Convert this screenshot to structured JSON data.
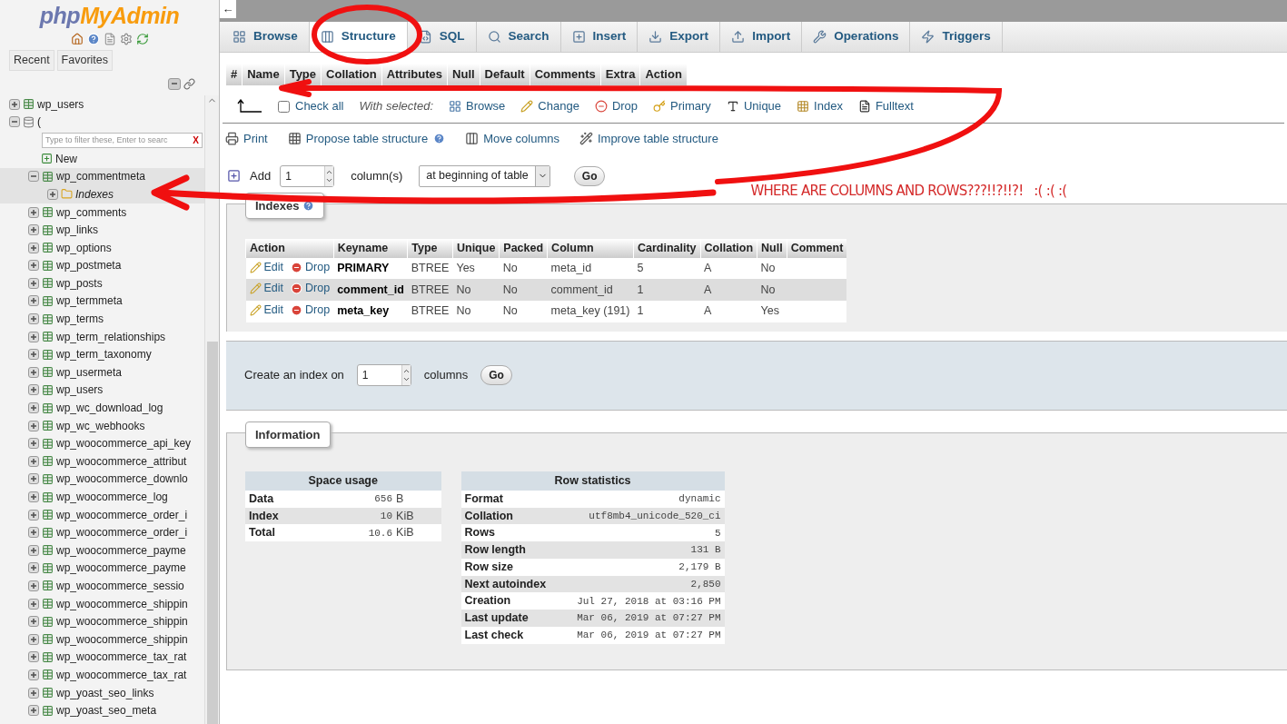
{
  "sidebar": {
    "logo": {
      "part_1": "php",
      "part_2": "MyAdmin"
    },
    "tabs": [
      {
        "label": "Recent"
      },
      {
        "label": "Favorites"
      }
    ],
    "tree": [
      {
        "label": "wp_users",
        "kind": "table",
        "expanded": false,
        "selected": false
      },
      {
        "label": "(",
        "kind": "database",
        "expanded": true,
        "filter_placeholder": "Type to filter these, Enter to searc",
        "filter_clear": "X",
        "children": [
          {
            "label": "New",
            "kind": "new"
          },
          {
            "label": "wp_commentmeta",
            "kind": "table",
            "expanded": true,
            "selected": true,
            "children": [
              {
                "label": "Indexes",
                "kind": "indexes",
                "expanded": false,
                "selected": true
              }
            ]
          },
          {
            "label": "wp_comments",
            "kind": "table",
            "expanded": false,
            "selected": false
          },
          {
            "label": "wp_links",
            "kind": "table",
            "expanded": false,
            "selected": false
          },
          {
            "label": "wp_options",
            "kind": "table",
            "expanded": false,
            "selected": false
          },
          {
            "label": "wp_postmeta",
            "kind": "table",
            "expanded": false,
            "selected": false
          },
          {
            "label": "wp_posts",
            "kind": "table",
            "expanded": false,
            "selected": false
          },
          {
            "label": "wp_termmeta",
            "kind": "table",
            "expanded": false,
            "selected": false
          },
          {
            "label": "wp_terms",
            "kind": "table",
            "expanded": false,
            "selected": false
          },
          {
            "label": "wp_term_relationships",
            "kind": "table",
            "expanded": false,
            "selected": false
          },
          {
            "label": "wp_term_taxonomy",
            "kind": "table",
            "expanded": false,
            "selected": false
          },
          {
            "label": "wp_usermeta",
            "kind": "table",
            "expanded": false,
            "selected": false
          },
          {
            "label": "wp_users",
            "kind": "table",
            "expanded": false,
            "selected": false
          },
          {
            "label": "wp_wc_download_log",
            "kind": "table",
            "expanded": false,
            "selected": false
          },
          {
            "label": "wp_wc_webhooks",
            "kind": "table",
            "expanded": false,
            "selected": false
          },
          {
            "label": "wp_woocommerce_api_key",
            "kind": "table",
            "expanded": false,
            "selected": false
          },
          {
            "label": "wp_woocommerce_attribut",
            "kind": "table",
            "expanded": false,
            "selected": false
          },
          {
            "label": "wp_woocommerce_downlo",
            "kind": "table",
            "expanded": false,
            "selected": false
          },
          {
            "label": "wp_woocommerce_log",
            "kind": "table",
            "expanded": false,
            "selected": false
          },
          {
            "label": "wp_woocommerce_order_i",
            "kind": "table",
            "expanded": false,
            "selected": false
          },
          {
            "label": "wp_woocommerce_order_i",
            "kind": "table",
            "expanded": false,
            "selected": false
          },
          {
            "label": "wp_woocommerce_payme",
            "kind": "table",
            "expanded": false,
            "selected": false
          },
          {
            "label": "wp_woocommerce_payme",
            "kind": "table",
            "expanded": false,
            "selected": false
          },
          {
            "label": "wp_woocommerce_sessio",
            "kind": "table",
            "expanded": false,
            "selected": false
          },
          {
            "label": "wp_woocommerce_shippin",
            "kind": "table",
            "expanded": false,
            "selected": false
          },
          {
            "label": "wp_woocommerce_shippin",
            "kind": "table",
            "expanded": false,
            "selected": false
          },
          {
            "label": "wp_woocommerce_shippin",
            "kind": "table",
            "expanded": false,
            "selected": false
          },
          {
            "label": "wp_woocommerce_tax_rat",
            "kind": "table",
            "expanded": false,
            "selected": false
          },
          {
            "label": "wp_woocommerce_tax_rat",
            "kind": "table",
            "expanded": false,
            "selected": false
          },
          {
            "label": "wp_yoast_seo_links",
            "kind": "table",
            "expanded": false,
            "selected": false
          },
          {
            "label": "wp_yoast_seo_meta",
            "kind": "table",
            "expanded": false,
            "selected": false
          }
        ]
      }
    ]
  },
  "back": "←",
  "tabs": [
    {
      "label": "Browse",
      "selected": false
    },
    {
      "label": "Structure",
      "selected": true
    },
    {
      "label": "SQL",
      "selected": false
    },
    {
      "label": "Search",
      "selected": false
    },
    {
      "label": "Insert",
      "selected": false
    },
    {
      "label": "Export",
      "selected": false
    },
    {
      "label": "Import",
      "selected": false
    },
    {
      "label": "Operations",
      "selected": false
    },
    {
      "label": "Triggers",
      "selected": false
    }
  ],
  "structure_columns": [
    "#",
    "Name",
    "Type",
    "Collation",
    "Attributes",
    "Null",
    "Default",
    "Comments",
    "Extra",
    "Action"
  ],
  "check_all": {
    "label": "Check all",
    "checked": false,
    "with_selected": "With selected:",
    "actions": [
      "Browse",
      "Change",
      "Drop",
      "Primary",
      "Unique",
      "Index",
      "Fulltext"
    ]
  },
  "tools": [
    "Print",
    "Propose table structure",
    "Move columns",
    "Improve table structure"
  ],
  "add_column": {
    "label": "Add",
    "value": "1",
    "unit": "column(s)",
    "position": "at beginning of table",
    "button": "Go"
  },
  "annotation": "WHERE ARE COLUMNS AND ROWS???!!?!!?!   :( :( :(",
  "indexes": {
    "legend": "Indexes",
    "columns": [
      "Action",
      "Keyname",
      "Type",
      "Unique",
      "Packed",
      "Column",
      "Cardinality",
      "Collation",
      "Null",
      "Comment"
    ],
    "rows": [
      {
        "edit": "Edit",
        "drop": "Drop",
        "keyname": "PRIMARY",
        "type": "BTREE",
        "unique": "Yes",
        "packed": "No",
        "column": "meta_id",
        "cardinality": "5",
        "collation": "A",
        "null": "No",
        "selected": false
      },
      {
        "edit": "Edit",
        "drop": "Drop",
        "keyname": "comment_id",
        "type": "BTREE",
        "unique": "No",
        "packed": "No",
        "column": "comment_id",
        "cardinality": "1",
        "collation": "A",
        "null": "No",
        "selected": true
      },
      {
        "edit": "Edit",
        "drop": "Drop",
        "keyname": "meta_key",
        "type": "BTREE",
        "unique": "No",
        "packed": "No",
        "column": "meta_key (191)",
        "cardinality": "1",
        "collation": "A",
        "null": "Yes",
        "selected": false
      }
    ]
  },
  "create_index": {
    "label": "Create an index on",
    "value": "1",
    "unit": "columns",
    "button": "Go"
  },
  "information": {
    "legend": "Information",
    "space_usage": {
      "title": "Space usage",
      "rows": [
        {
          "label": "Data",
          "value": "656",
          "unit": "B"
        },
        {
          "label": "Index",
          "value": "10",
          "unit": "KiB"
        },
        {
          "label": "Total",
          "value": "10.6",
          "unit": "KiB"
        }
      ]
    },
    "row_statistics": {
      "title": "Row statistics",
      "rows": [
        {
          "label": "Format",
          "value": "dynamic"
        },
        {
          "label": "Collation",
          "value": "utf8mb4_unicode_520_ci"
        },
        {
          "label": "Rows",
          "value": "5"
        },
        {
          "label": "Row length",
          "value": "131 B"
        },
        {
          "label": "Row size",
          "value": "2,179 B"
        },
        {
          "label": "Next autoindex",
          "value": "2,850"
        },
        {
          "label": "Creation",
          "value": "Jul 27, 2018 at 03:16 PM"
        },
        {
          "label": "Last update",
          "value": "Mar 06, 2019 at 07:27 PM"
        },
        {
          "label": "Last check",
          "value": "Mar 06, 2019 at 07:27 PM"
        }
      ]
    }
  }
}
